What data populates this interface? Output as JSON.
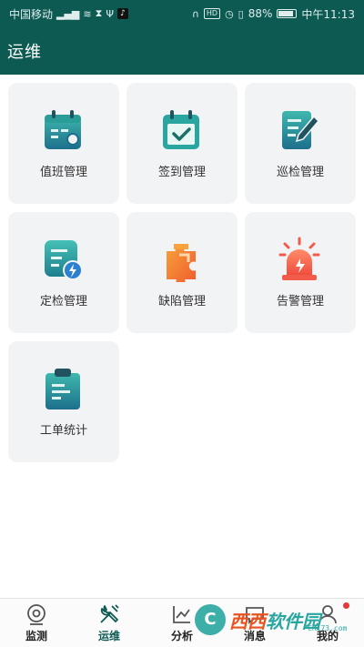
{
  "status_bar": {
    "carrier": "中国移动",
    "signal_text": "⁴ᴳ",
    "hd_badge": "HD",
    "battery": "88%",
    "time": "中午11:13"
  },
  "header": {
    "title": "运维"
  },
  "tiles": [
    {
      "label": "值班管理",
      "icon": "duty-calendar-icon"
    },
    {
      "label": "签到管理",
      "icon": "checkin-calendar-icon"
    },
    {
      "label": "巡检管理",
      "icon": "inspection-doc-icon"
    },
    {
      "label": "定检管理",
      "icon": "scheduled-check-icon"
    },
    {
      "label": "缺陷管理",
      "icon": "puzzle-icon"
    },
    {
      "label": "告警管理",
      "icon": "alarm-siren-icon"
    },
    {
      "label": "工单统计",
      "icon": "clipboard-icon"
    }
  ],
  "bottom_nav": [
    {
      "label": "监测",
      "icon": "monitor-camera-icon",
      "active": false
    },
    {
      "label": "运维",
      "icon": "tools-icon",
      "active": true
    },
    {
      "label": "分析",
      "icon": "chart-icon",
      "active": false
    },
    {
      "label": "消息",
      "icon": "message-icon",
      "active": false
    },
    {
      "label": "我的",
      "icon": "user-icon",
      "active": false
    }
  ],
  "watermark": {
    "part1": "西西",
    "part2": "软件园",
    "sub": "CR173.com"
  },
  "colors": {
    "primary": "#0d5a53",
    "tile_bg": "#f2f3f5",
    "accent_orange": "#f28a2e",
    "accent_red": "#f25a4a"
  }
}
